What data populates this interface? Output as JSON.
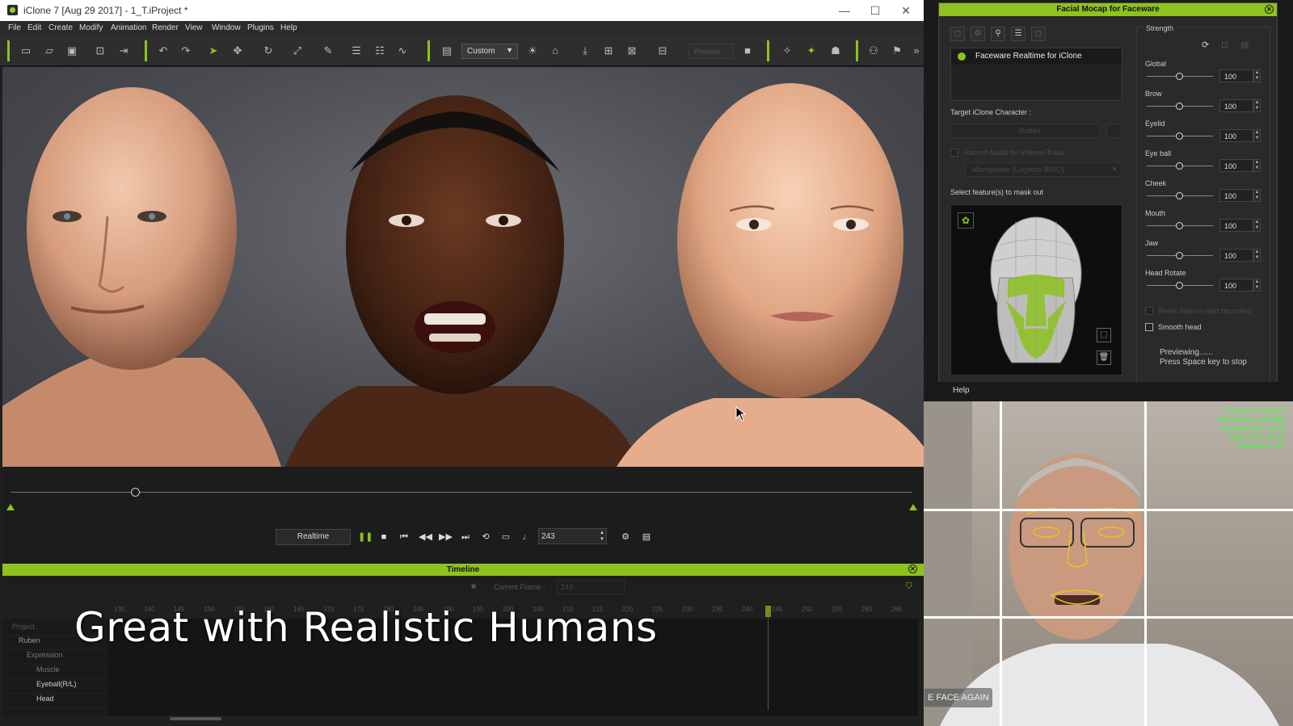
{
  "window": {
    "title": "iClone 7 [Aug 29 2017] - 1_T.iProject *",
    "minimize": "—",
    "maximize": "☐",
    "close": "✕"
  },
  "menu": [
    "File",
    "Edit",
    "Create",
    "Modify",
    "Animation",
    "Render",
    "View",
    "Window",
    "Plugins",
    "Help"
  ],
  "toolbar": {
    "preset": "Custom",
    "preview": "Preview",
    "more": "»"
  },
  "playback": {
    "mode": "Realtime",
    "frame": "243"
  },
  "timeline": {
    "title": "Timeline",
    "current_frame_label": "Current Frame :",
    "current_frame": "243",
    "ruler": [
      "135",
      "140",
      "145",
      "150",
      "155",
      "160",
      "165",
      "170",
      "175",
      "180",
      "185",
      "190",
      "195",
      "200",
      "205",
      "210",
      "215",
      "220",
      "225",
      "230",
      "235",
      "240",
      "245",
      "250",
      "255",
      "260",
      "265"
    ],
    "tracks": [
      "Project",
      "Ruben",
      "Expression",
      "Muscle",
      "Eyeball(R/L)",
      "Head"
    ]
  },
  "caption": "Great with Realistic Humans",
  "mocap": {
    "title": "Facial Mocap for Faceware",
    "device": "Faceware Realtime for iClone",
    "target_label": "Target iClone Character :",
    "target_value": "Ruben",
    "record_audio": "Record Audio for Viseme Track",
    "microphone": "Microphone (Logitech BRIO)",
    "mask_label": "Select feature(s) to mask out",
    "strength_title": "Strength",
    "sliders": [
      {
        "label": "Global",
        "value": "100",
        "level": 0.5
      },
      {
        "label": "Brow",
        "value": "100",
        "level": 0.5
      },
      {
        "label": "Eyelid",
        "value": "100",
        "level": 0.5
      },
      {
        "label": "Eye ball",
        "value": "100",
        "level": 0.5
      },
      {
        "label": "Cheek",
        "value": "100",
        "level": 0.5
      },
      {
        "label": "Mouth",
        "value": "100",
        "level": 0.5
      },
      {
        "label": "Jaw",
        "value": "100",
        "level": 0.5
      },
      {
        "label": "Head Rotate",
        "value": "100",
        "level": 0.5
      }
    ],
    "reset_option": "Reset data on next recording",
    "smooth_head": "Smooth head",
    "status_1": "Previewing......",
    "status_2": "Press Space key to stop",
    "help": "Help",
    "info": "i"
  },
  "webcam": {
    "stats": [
      "iClone: Connected",
      "Resolution: 640x480",
      "Tracking FPS: 29.00",
      "Video FPS: 30.15",
      "Calibrated: Yes"
    ],
    "calibrate": "E FACE AGAIN"
  },
  "colors": {
    "accent": "#8dc21f",
    "stats": "#3dff3d"
  }
}
